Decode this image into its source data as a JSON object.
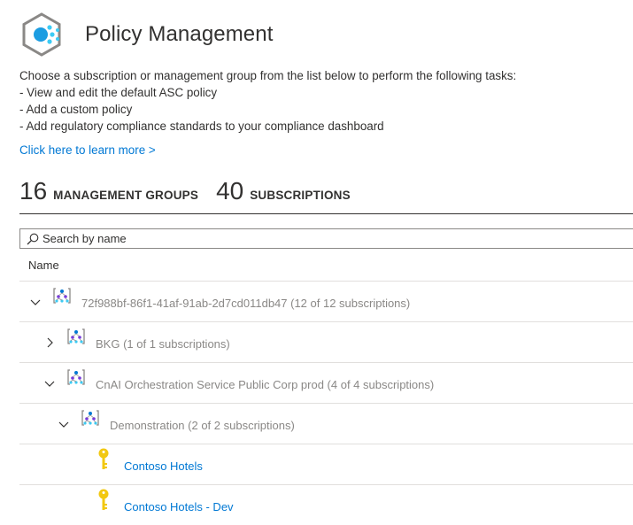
{
  "header": {
    "title": "Policy Management",
    "logo_icon": "security-center-hex-icon"
  },
  "description": {
    "intro": "Choose a subscription or management group from the list below to perform the following tasks:",
    "tasks": [
      "- View and edit the default ASC policy",
      "- Add a custom policy",
      "- Add regulatory compliance standards to your compliance dashboard"
    ]
  },
  "learn_more": "Click here to learn more >",
  "stats": {
    "management_groups_count": "16",
    "management_groups_label": "MANAGEMENT GROUPS",
    "subscriptions_count": "40",
    "subscriptions_label": "SUBSCRIPTIONS"
  },
  "search": {
    "placeholder": "Search by name"
  },
  "table": {
    "column_name": "Name",
    "rows": [
      {
        "type": "management-group",
        "expanded": true,
        "label": "72f988bf-86f1-41af-91ab-2d7cd011db47 (12 of 12 subscriptions)"
      },
      {
        "type": "management-group",
        "expanded": false,
        "label": "BKG (1 of 1 subscriptions)"
      },
      {
        "type": "management-group",
        "expanded": true,
        "label": "CnAI Orchestration Service Public Corp prod (4 of 4 subscriptions)"
      },
      {
        "type": "management-group",
        "expanded": true,
        "label": "Demonstration (2 of 2 subscriptions)"
      },
      {
        "type": "subscription",
        "label": "Contoso Hotels"
      },
      {
        "type": "subscription",
        "label": "Contoso Hotels - Dev"
      }
    ]
  },
  "colors": {
    "link": "#0078d4",
    "muted_text": "#8a8886",
    "key_icon": "#f2c811",
    "logo_accent": "#3ccbf4"
  }
}
